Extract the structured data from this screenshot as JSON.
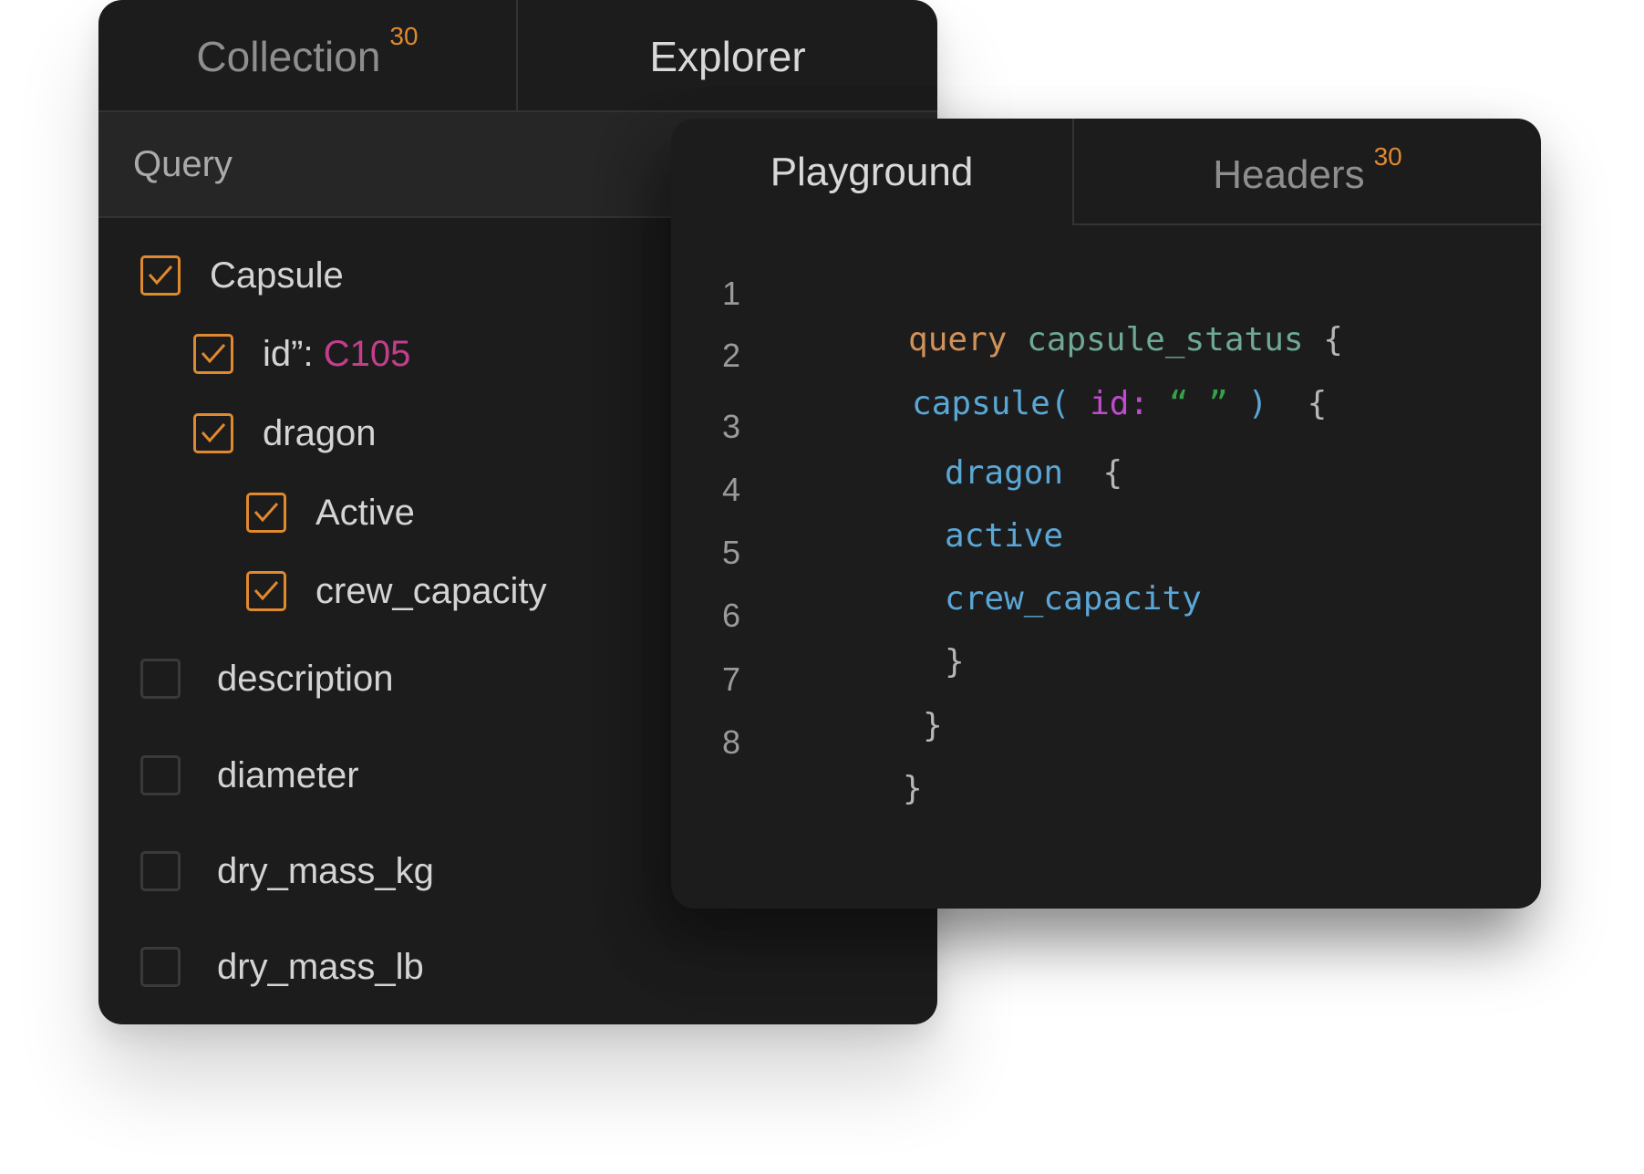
{
  "explorer": {
    "tabs": {
      "collection_label": "Collection",
      "collection_badge": "30",
      "explorer_label": "Explorer"
    },
    "query_label": "Query",
    "tree": [
      {
        "label": "Capsule",
        "checked": true
      },
      {
        "label": "id”: ",
        "value": "C105",
        "checked": true
      },
      {
        "label": "dragon",
        "checked": true
      },
      {
        "label": "Active",
        "checked": true
      },
      {
        "label": "crew_capacity",
        "checked": true
      },
      {
        "label": "description",
        "checked": false
      },
      {
        "label": "diameter",
        "checked": false
      },
      {
        "label": "dry_mass_kg",
        "checked": false
      },
      {
        "label": "dry_mass_lb",
        "checked": false
      }
    ]
  },
  "playground": {
    "tabs": {
      "playground_label": "Playground",
      "headers_label": "Headers",
      "headers_badge": "30"
    },
    "line_numbers": [
      "1",
      "2",
      "3",
      "4",
      "5",
      "6",
      "7",
      "8"
    ],
    "code": {
      "l1_keyword": "query",
      "l1_name": "capsule_status",
      "l1_brace": "{",
      "l2_field": "capsule(",
      "l2_arg": "id:",
      "l2_open_quote": "“",
      "l2_close_quote": "”",
      "l2_paren": ")",
      "l2_brace": "{",
      "l3_field": "dragon",
      "l3_brace": "{",
      "l4_field": "active",
      "l5_field": "crew_capacity",
      "l6_brace": "}",
      "l7_brace": "}",
      "l8_brace": "}"
    }
  },
  "colors": {
    "panel_bg": "#1c1c1c",
    "accent_orange": "#e0892f",
    "value_magenta": "#c43e8c",
    "keyword": "#d0915a",
    "name": "#6fa895",
    "field": "#5aa7d6",
    "arg": "#c04bd0",
    "string": "#35a24a"
  },
  "icons": {
    "checked": "checkbox-checked-icon",
    "unchecked": "checkbox-empty-icon"
  }
}
